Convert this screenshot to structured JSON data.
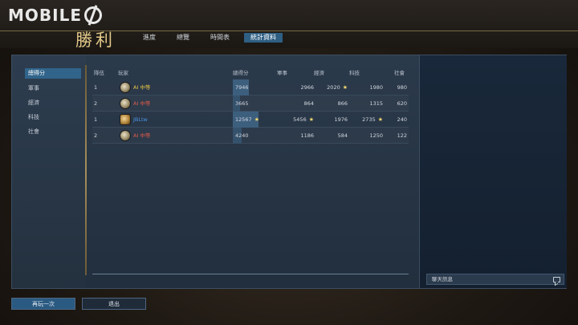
{
  "brand": {
    "logo_text": "MOBILE"
  },
  "header": {
    "title": "勝利",
    "tabs": [
      {
        "label": "進度",
        "active": false
      },
      {
        "label": "總覽",
        "active": false
      },
      {
        "label": "時間表",
        "active": false
      },
      {
        "label": "統計資料",
        "active": true
      }
    ]
  },
  "sidebar": {
    "categories": [
      {
        "label": "總得分",
        "active": true
      },
      {
        "label": "軍事",
        "active": false
      },
      {
        "label": "經濟",
        "active": false
      },
      {
        "label": "科技",
        "active": false
      },
      {
        "label": "社會",
        "active": false
      }
    ]
  },
  "table": {
    "columns": [
      "隊伍",
      "玩家",
      "總得分",
      "軍事",
      "經濟",
      "科技",
      "社會"
    ],
    "rows": [
      {
        "team": "1",
        "player": "AI 中等",
        "player_color": "#e8c547",
        "total": "7946",
        "total_ratio": 0.63,
        "military": "2966",
        "military_star": false,
        "economy": "2020",
        "economy_star": true,
        "tech": "1980",
        "tech_star": false,
        "society": "980",
        "society_star": false,
        "avatar": "ai-avatar-icon"
      },
      {
        "team": "2",
        "player": "AI 中等",
        "player_color": "#e05a4a",
        "total": "3665",
        "total_ratio": 0.29,
        "military": "864",
        "military_star": false,
        "economy": "866",
        "economy_star": false,
        "tech": "1315",
        "tech_star": false,
        "society": "620",
        "society_star": false,
        "avatar": "ai-avatar-icon"
      },
      {
        "team": "1",
        "player": "JBLtw",
        "player_color": "#4a93e0",
        "total": "12567",
        "total_ratio": 1.0,
        "military": "5456",
        "military_star": true,
        "economy": "1976",
        "economy_star": false,
        "tech": "2735",
        "tech_star": true,
        "society": "240",
        "society_star": false,
        "avatar": "player-avatar-icon"
      },
      {
        "team": "2",
        "player": "AI 中等",
        "player_color": "#e05a4a",
        "total": "4240",
        "total_ratio": 0.34,
        "military": "1186",
        "military_star": false,
        "economy": "584",
        "economy_star": false,
        "tech": "1250",
        "tech_star": false,
        "society": "122",
        "society_star": false,
        "avatar": "ai-avatar-icon"
      }
    ],
    "star_glyph": "★"
  },
  "chat": {
    "label": "聊天訊息"
  },
  "footer": {
    "play_again_label": "再玩一次",
    "exit_label": "退出"
  },
  "colors": {
    "accent": "#2f5f83",
    "gold": "#e3c98a",
    "star": "#f1d86e"
  }
}
